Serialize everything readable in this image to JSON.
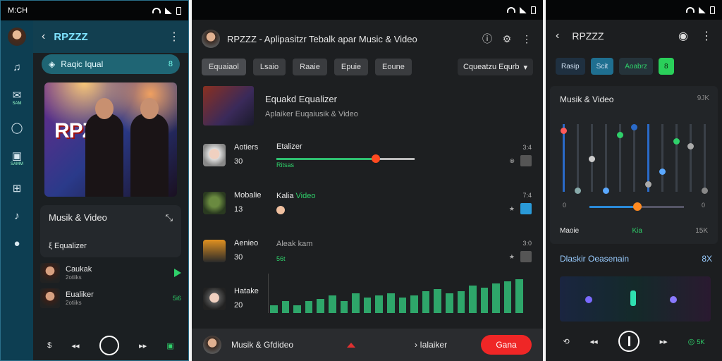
{
  "left_phone": {
    "status_time": "M:CH",
    "header_title": "RPZZZ",
    "pill_label": "Raqic Iqual",
    "pill_badge": "8",
    "album_logo": "RPZZZ",
    "rail": [
      {
        "icon": "avatar",
        "label": ""
      },
      {
        "icon": "music-note-icon",
        "label": ""
      },
      {
        "icon": "mail-icon",
        "label": "SAM"
      },
      {
        "icon": "chat-icon",
        "label": ""
      },
      {
        "icon": "clipboard-icon",
        "label": "SAMM"
      },
      {
        "icon": "grid-icon",
        "label": ""
      },
      {
        "icon": "note-icon",
        "label": ""
      },
      {
        "icon": "person-icon",
        "label": ""
      }
    ],
    "card_title": "Musik & Video",
    "card_sub": "ξ Equalizer",
    "tracks": [
      {
        "name": "Caukak",
        "sub": "2otiiks"
      },
      {
        "name": "Eualiker",
        "sub": "2otiiks",
        "tag": "5i6"
      }
    ]
  },
  "center_phone": {
    "title": "RPZZZ - Aplipasitzr Tebalk apar Music & Video",
    "chips": [
      "Equaiaol",
      "Lsaio",
      "Raaie",
      "Epuie",
      "Eoune"
    ],
    "dropdown": "Cqueatzu Equrb",
    "feature": {
      "title": "Equakd Equalizer",
      "sub": "Aplaiker Euqaiusik & Video"
    },
    "items": [
      {
        "name": "Aotiers",
        "num": "30",
        "mid": "Etalizer",
        "tag": "Ritsas",
        "time": "3:4",
        "slider": 0.72
      },
      {
        "name": "Mobalie",
        "num": "13",
        "mid": "Kalia",
        "mid_green": "Video",
        "time": "7:4",
        "slider": null
      },
      {
        "name": "Aenieo",
        "num": "30",
        "mid": "Aleak kam",
        "tag": "56t",
        "time": "3:0",
        "slider": null
      },
      {
        "name": "Hatake",
        "num": "20",
        "mid": "",
        "tag": "",
        "time": "",
        "slider": null
      }
    ],
    "eq_bars": [
      20,
      30,
      20,
      30,
      35,
      45,
      30,
      50,
      40,
      45,
      50,
      40,
      45,
      55,
      60,
      50,
      55,
      70,
      65,
      75,
      80,
      85
    ],
    "footer": {
      "now_playing": "Musik & Gfdideo",
      "label_right": "Ialaiker",
      "send": "Gana"
    }
  },
  "right_phone": {
    "title": "RPZZZ",
    "tabs": [
      "Rasip",
      "Scit",
      "Aoabrz",
      "8"
    ],
    "panel_title": "Musik & Video",
    "panel_value": "9JK",
    "zero_left": "0",
    "zero_right": "0",
    "foot_left": "Maoie",
    "foot_mid": "Kia",
    "foot_right": "15K",
    "section2_title": "Dlaskir Oeasenain",
    "section2_value": "8X",
    "eq_levels": [
      0.95,
      0.0,
      0.5,
      0.0,
      0.88,
      1.0,
      0.1,
      0.3,
      0.78,
      0.7,
      0.0
    ],
    "eq_colors": [
      "#ff5a5a",
      "#8aa",
      "#ccc",
      "#5aa8ff",
      "#2fd06a",
      "#2a6ac8",
      "#aaa",
      "#5aa8ff",
      "#2fd06a",
      "#aaa",
      "#888"
    ],
    "ctrl_tag": "5K"
  },
  "colors": {
    "accent_green": "#2fd06a",
    "accent_red": "#ef2626",
    "accent_blue": "#2a8ad8",
    "teal": "#1f6574"
  }
}
